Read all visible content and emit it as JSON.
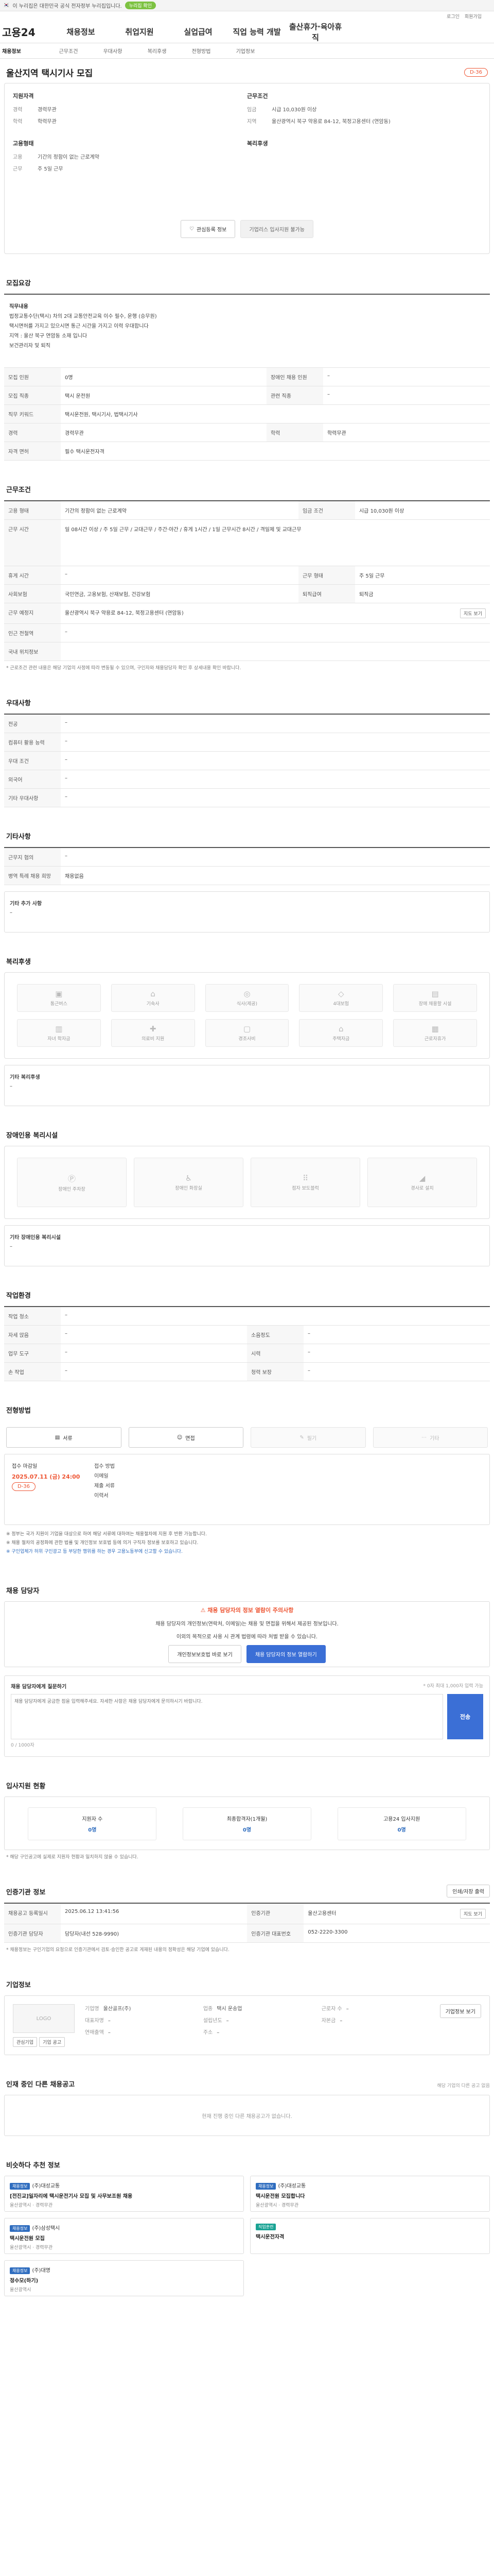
{
  "topbar": {
    "notice": "이 누리집은 대한민국 공식 전자정부 누리집입니다.",
    "badge": "누리집 확인"
  },
  "util": [
    "로그인",
    "회원가입"
  ],
  "gnb": {
    "logo": "고용24",
    "items": [
      "채용정보",
      "취업지원",
      "실업급여",
      "직업 능력 개발",
      "출산휴가·육아휴직"
    ]
  },
  "subnav": [
    "채용정보",
    "근무조건",
    "우대사항",
    "복리후생",
    "전형방법",
    "기업정보"
  ],
  "job": {
    "title": "울산지역 택시기사 모집",
    "dday": "D-36",
    "summary": {
      "left_head": "지원자격",
      "left": [
        {
          "k": "경력",
          "v": "경력무관"
        },
        {
          "k": "학력",
          "v": "학력무관"
        }
      ],
      "right_head": "근무조건",
      "right": [
        {
          "k": "임금",
          "v": "시급 10,030원 이상"
        },
        {
          "k": "지역",
          "v": "울산광역시 북구 약용로 84-12, 북정고용센터 (연암동)"
        }
      ],
      "left2_head": "고용형태",
      "left2": [
        {
          "k": "고용",
          "v": "기간의 정함이 없는 근로계약"
        },
        {
          "k": "근무",
          "v": "주 5일 근무"
        }
      ],
      "right2_head": "복리후생",
      "btn_like": "관심등록 정보",
      "btn_related": "기업리스 입사지원 불가능"
    }
  },
  "recruit": {
    "section": "모집요강",
    "req_lines": [
      "직무내용",
      "법정교통수단(택시) 차의 2대 교통안전교육 이수 필수, 운행 (승무원)",
      "택시면허를 가지고 있으시면 통근 시간을 가지고 이력 우대합니다",
      "지역 : 울산 북구 연암동 소재 입니다",
      "보건관리자 및 퇴직"
    ],
    "rows": [
      {
        "k": "모집 인원",
        "v": "0명",
        "k2": "장애인 채용 인원",
        "v2": "–"
      },
      {
        "k": "모집 직종",
        "v": "택시 운전원",
        "k2": "관련 직종",
        "v2": "–"
      },
      {
        "k": "직무 키워드",
        "v": "택시운전원, 택시기사, 법택시기사",
        "k2": "",
        "v2": ""
      },
      {
        "k": "경력",
        "v": "경력무관",
        "k2": "학력",
        "v2": "학력무관"
      },
      {
        "k": "자격 면허",
        "v": "필수  택시운전자격",
        "k2": "",
        "v2": ""
      }
    ]
  },
  "conditions": {
    "section": "근무조건",
    "rows": [
      {
        "k": "고용 형태",
        "v": "기간의 정함이 없는 근로계약",
        "k2": "임금 조건",
        "v2": "시급 10,030원 이상"
      },
      {
        "k": "근무 시간",
        "v": "일 08시간 이상 / 주 5일 근무 / 교대근무 / 주간·야간 / 휴게 1시간 / 1일 근무시간 8시간 / 격일제 및 교대근무",
        "k2": "",
        "v2": ""
      },
      {
        "k": "휴게 시간",
        "v": "–",
        "k2": "근무 형태",
        "v2": "주 5일 근무"
      },
      {
        "k": "사회보험",
        "v": "국민연금, 고용보험, 산재보험, 건강보험",
        "k2": "퇴직급여",
        "v2": "퇴직금"
      },
      {
        "k": "근무 예정지",
        "v": "울산광역시 북구 약용로 84-12, 북정고용센터 (연암동)",
        "k2": "",
        "v2": ""
      },
      {
        "k": "인근 전철역",
        "v": "–",
        "k2": "",
        "v2": ""
      },
      {
        "k": "국내 위치정보",
        "v": "",
        "k2": "",
        "v2": ""
      }
    ],
    "map_btn": "지도 보기",
    "note": "* 근로조건 관련 내용은 해당 기업의 사정에 따라 변동될 수 있으며, 구인자와 채용담당자 확인 후 상세내용 확인 바랍니다."
  },
  "preference": {
    "section": "우대사항",
    "rows": [
      {
        "k": "전공",
        "v": "–"
      },
      {
        "k": "컴퓨터 활용 능력",
        "v": "–"
      },
      {
        "k": "우대 조건",
        "v": "–"
      },
      {
        "k": "외국어",
        "v": "–"
      },
      {
        "k": "기타 우대사항",
        "v": "–"
      }
    ]
  },
  "other": {
    "section": "기타사항",
    "rows": [
      {
        "k": "근무지 협의",
        "v": "–"
      },
      {
        "k": "병역 특례 채용 희망",
        "v": "채용없음"
      }
    ],
    "box_head": "기타 추가 사항",
    "box_text": "–"
  },
  "welfare": {
    "section": "복리후생",
    "items": [
      "통근버스",
      "기숙사",
      "식사(제공)",
      "4대보험",
      "장애 채용할 시설",
      "자녀 학자금",
      "의료비 지원",
      "경조사비",
      "주택자금",
      "근로자휴가"
    ],
    "box_head": "기타 복리후생",
    "box_text": "–"
  },
  "disability": {
    "section": "장애인용 복리시설",
    "items": [
      "장애인 주차장",
      "장애인 화장실",
      "점자 보도블럭",
      "경사로 설치"
    ],
    "box_head": "기타 장애인용 복리시설",
    "box_text": "–"
  },
  "env": {
    "section": "작업환경",
    "rows": [
      {
        "k": "작업 청소",
        "v": "–",
        "k2": "",
        "v2": ""
      },
      {
        "k": "자세 앉음",
        "v": "–",
        "k2": "소음정도",
        "v2": "–"
      },
      {
        "k": "업무 도구",
        "v": "–",
        "k2": "시력",
        "v2": "–"
      },
      {
        "k": "손 작업",
        "v": "–",
        "k2": "청력 보장",
        "v2": "–"
      }
    ]
  },
  "apply": {
    "section": "전형방법",
    "methods": [
      {
        "label": "서류",
        "on": true
      },
      {
        "label": "면접",
        "on": true
      },
      {
        "label": "필기",
        "on": false
      },
      {
        "label": "기타",
        "on": false
      }
    ],
    "deadline_label": "접수 마감일",
    "deadline": "2025.07.11 (금) 24:00",
    "deadline_tag": "D-36",
    "right_lines": [
      "접수 방법",
      "이메일",
      "",
      "제출 서류",
      "이력서"
    ],
    "notes": [
      "※ 정부는 국가 지원이 기업을 대상으로 하여 해당 서류에 대하여는 채용절차에 지원 후 반환 가능합니다.",
      "※ 채용 절차의 공정화에 관한 법률 및 개인정보 보호법 등에 의거 구직자 정보를 보호하고 있습니다.",
      "※ 구인업체가 허위 구인광고 등 부당한 행위를 하는 경우 고용노동부에 신고할 수 있습니다."
    ]
  },
  "contact": {
    "section": "채용 담당자",
    "warn": "채용 담당자의 정보 열람이 주의사항",
    "desc1": "채용 담당자의 개인정보(연락처, 이메일)는 채용 및 면접을 위해서 제공된 정보입니다.",
    "desc2": "이외의 목적으로 사용 시 관계 법령에 따라 처벌 받을 수 있습니다.",
    "btn1": "개인정보보호법 바로 보기",
    "btn2": "채용 담당자의 정보 열람하기",
    "inq_head": "채용 담당자에게 질문하기",
    "inq_note": "* 0자 최대 1,000자 입력 가능",
    "inq_placeholder": "채용 담당자에게 궁금한 점을 입력해주세요. 자세한 사항은 채용 담당자에게 문의하시기 바랍니다.",
    "inq_count": "0 / 1000자",
    "send": "전송"
  },
  "stats": {
    "section": "입사지원 현황",
    "items": [
      {
        "k": "지원자 수",
        "v": "0명"
      },
      {
        "k": "최종합격자(1개월)",
        "v": "0명"
      },
      {
        "k": "고용24 입사지원",
        "v": "0명"
      }
    ],
    "note": "* 해당 구인공고에 실제로 지원자 현황과 일치하지 않을 수 있습니다."
  },
  "info": {
    "section": "인증기관 정보",
    "print_btn": "인쇄/저장 출력",
    "rows": [
      {
        "k": "채용공고 등록일시",
        "v": "2025.06.12 13:41:56",
        "k2": "인증기관",
        "v2": "울산고용센터"
      },
      {
        "k": "인증기관 담당자",
        "v": "담당자(내선 528-9990)",
        "k2": "인증기관 대표번호",
        "v2": "052-2220-3300"
      }
    ],
    "map_btn": "지도 보기",
    "note": "* 채용정보는 구인기업의 요청으로 인증기관에서 검토·승인한 공고로 게재된 내용의 정확성은 해당 기업에 있습니다."
  },
  "company": {
    "section": "기업정보",
    "logo": "LOGO",
    "name_btn": "기업정보 보기",
    "fields": [
      {
        "k": "기업명",
        "v": "울산골프(주)"
      },
      {
        "k": "업종",
        "v": "택시 운송업"
      },
      {
        "k": "근로자 수",
        "v": "–"
      },
      {
        "k": "대표자명",
        "v": "–"
      },
      {
        "k": "설립년도",
        "v": "–"
      },
      {
        "k": "자본금",
        "v": "–"
      },
      {
        "k": "연매출액",
        "v": "–"
      },
      {
        "k": "주소",
        "v": "–"
      }
    ],
    "btn_a": "관심기업",
    "btn_b": "기업 공고"
  },
  "others": {
    "section": "인재 중인 다른 채용공고",
    "right": "해당 기업의 다른 공고 없음",
    "empty": "현재 진행 중인 다른 채용공고가 없습니다."
  },
  "recommend": {
    "section": "비슷하다 추천 정보",
    "cards": [
      {
        "label": "채용정보",
        "green": false,
        "company": "(주)대성교통",
        "title": "[전진교]일자리에 택시운전기사 모집 및 사무보조원 채용",
        "meta": "울산광역시 · 경력무관"
      },
      {
        "label": "채용정보",
        "green": false,
        "company": "(주)대성교통",
        "title": "택시운전원 모집합니다",
        "meta": "울산광역시 · 경력무관"
      },
      {
        "label": "채용정보",
        "green": false,
        "company": "(주)삼성택시",
        "title": "택시운전원 모집",
        "meta": "울산광역시 · 경력무관"
      },
      {
        "label": "직업훈련",
        "green": true,
        "company": "",
        "title": "택시운전자격",
        "meta": ""
      },
      {
        "label": "채용정보",
        "green": false,
        "company": "(주)대명",
        "title": "정수모(하기)",
        "meta": "울산광역시"
      }
    ]
  }
}
